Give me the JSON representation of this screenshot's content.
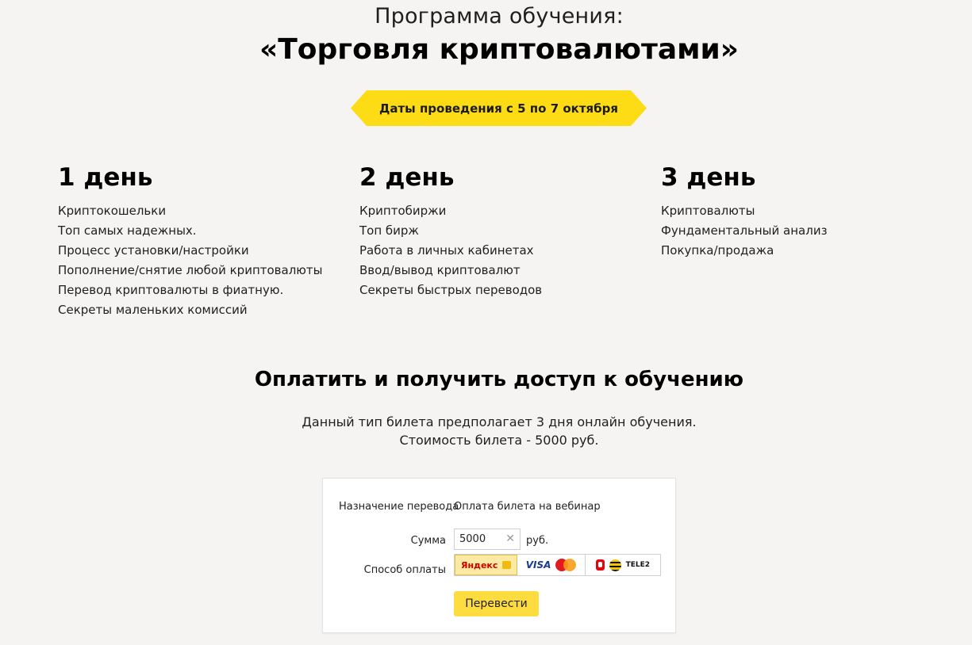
{
  "header": {
    "subtitle": "Программа обучения:",
    "title": "«Торговля криптовалютами»",
    "dates": "Даты проведения с 5 по 7 октября"
  },
  "days": [
    {
      "title": "1 день",
      "items": [
        "Криптокошельки",
        "Топ самых надежных.",
        "Процесс установки/настройки",
        "Пополнение/снятие любой криптовалюты",
        "Перевод криптовалюты в фиатную.",
        "Секреты маленьких комиссий"
      ]
    },
    {
      "title": "2 день",
      "items": [
        "Криптобиржи",
        "Топ бирж",
        "Работа в личных кабинетах",
        "Ввод/вывод криптовалют",
        "Секреты быстрых переводов"
      ]
    },
    {
      "title": "3 день",
      "items": [
        "Криптовалюты",
        "Фундаментальный анализ",
        "Покупка/продажа"
      ]
    }
  ],
  "payment": {
    "title": "Оплатить и получить доступ к обучению",
    "description_line1": "Данный тип билета предполагает 3 дня онлайн обучения.",
    "description_line2": "Стоимость билета - 5000 руб."
  },
  "widget": {
    "purpose_label": "Назначение перевода",
    "purpose_value": "Оплата билета на вебинар",
    "amount_label": "Сумма",
    "amount_value": "5000",
    "currency": "руб.",
    "method_label": "Способ оплаты",
    "yandex_label": "Яндекс",
    "visa_label": "VISA",
    "tele2_label": "TELE2",
    "submit_label": "Перевести",
    "clear_symbol": "✕"
  },
  "colors": {
    "accent": "#fddc16",
    "background": "#f5f4f2",
    "button": "#fddc3f"
  }
}
